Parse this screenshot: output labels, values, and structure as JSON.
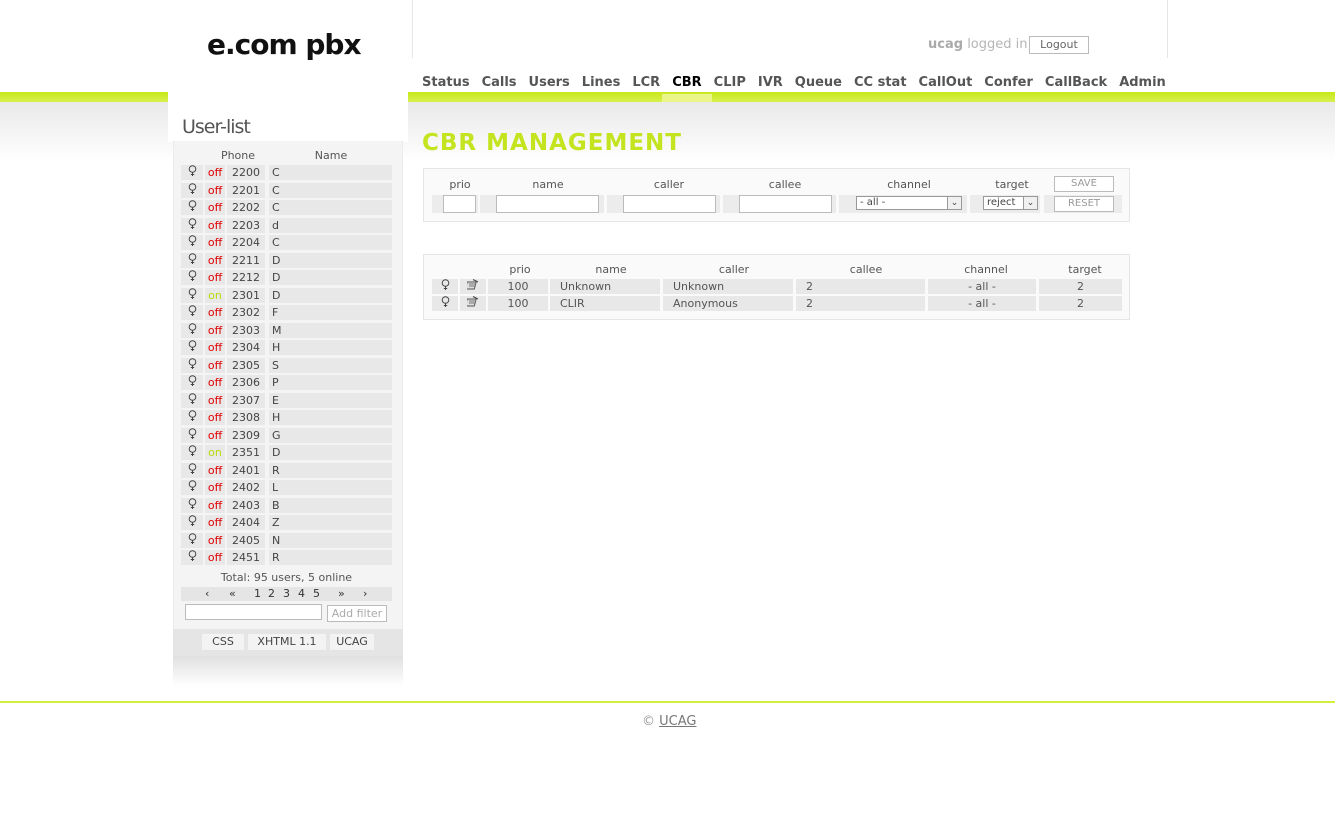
{
  "header": {
    "logo": "e.com pbx",
    "username": "ucag",
    "logged_in_text": "logged in",
    "logout_label": "Logout"
  },
  "nav": [
    "Status",
    "Calls",
    "Users",
    "Lines",
    "LCR",
    "CBR",
    "CLIP",
    "IVR",
    "Queue",
    "CC stat",
    "CallOut",
    "Confer",
    "CallBack",
    "Admin"
  ],
  "nav_active": "CBR",
  "sidebar": {
    "title": "User-list",
    "col_phone": "Phone",
    "col_name": "Name",
    "users": [
      {
        "status": "off",
        "phone": "2200",
        "name": "C"
      },
      {
        "status": "off",
        "phone": "2201",
        "name": "C"
      },
      {
        "status": "off",
        "phone": "2202",
        "name": "C"
      },
      {
        "status": "off",
        "phone": "2203",
        "name": "d"
      },
      {
        "status": "off",
        "phone": "2204",
        "name": "C"
      },
      {
        "status": "off",
        "phone": "2211",
        "name": "D"
      },
      {
        "status": "off",
        "phone": "2212",
        "name": "D"
      },
      {
        "status": "on",
        "phone": "2301",
        "name": "D"
      },
      {
        "status": "off",
        "phone": "2302",
        "name": "F"
      },
      {
        "status": "off",
        "phone": "2303",
        "name": "M"
      },
      {
        "status": "off",
        "phone": "2304",
        "name": "H"
      },
      {
        "status": "off",
        "phone": "2305",
        "name": "S"
      },
      {
        "status": "off",
        "phone": "2306",
        "name": "P"
      },
      {
        "status": "off",
        "phone": "2307",
        "name": "E"
      },
      {
        "status": "off",
        "phone": "2308",
        "name": "H"
      },
      {
        "status": "off",
        "phone": "2309",
        "name": "G"
      },
      {
        "status": "on",
        "phone": "2351",
        "name": "D"
      },
      {
        "status": "off",
        "phone": "2401",
        "name": "R"
      },
      {
        "status": "off",
        "phone": "2402",
        "name": "L"
      },
      {
        "status": "off",
        "phone": "2403",
        "name": "B"
      },
      {
        "status": "off",
        "phone": "2404",
        "name": "Z"
      },
      {
        "status": "off",
        "phone": "2405",
        "name": "N"
      },
      {
        "status": "off",
        "phone": "2451",
        "name": "R"
      }
    ],
    "total": "Total: 95 users, 5 online",
    "pager": [
      "‹",
      "«",
      "1",
      "2",
      "3",
      "4",
      "5",
      "»",
      "›"
    ],
    "filter_value": "",
    "filter_button": "Add filter",
    "badges": [
      "CSS",
      "XHTML 1.1",
      "UCAG"
    ]
  },
  "main": {
    "title": "CBR MANAGEMENT",
    "form": {
      "labels": {
        "prio": "prio",
        "name": "name",
        "caller": "caller",
        "callee": "callee",
        "channel": "channel",
        "target": "target"
      },
      "channel_selected": "- all -",
      "target_selected": "reject",
      "save_label": "SAVE",
      "reset_label": "RESET"
    },
    "list": {
      "headers": {
        "prio": "prio",
        "name": "name",
        "caller": "caller",
        "callee": "callee",
        "channel": "channel",
        "target": "target"
      },
      "rows": [
        {
          "prio": "100",
          "name": "Unknown",
          "caller": "Unknown",
          "callee": "2",
          "channel": "- all -",
          "target": "2"
        },
        {
          "prio": "100",
          "name": "CLIR",
          "caller": "Anonymous",
          "callee": "2",
          "channel": "- all -",
          "target": "2"
        }
      ]
    }
  },
  "footer": {
    "copyright": "©",
    "link": "UCAG"
  },
  "colors": {
    "accent": "#c3e41e",
    "off": "#e00000",
    "on": "#b8d90c"
  }
}
